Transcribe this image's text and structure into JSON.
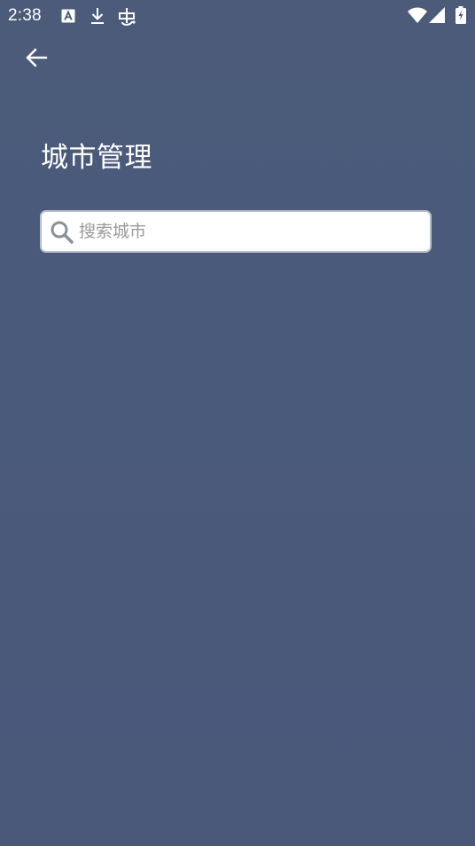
{
  "status_bar": {
    "time": "2:38",
    "left_icons": [
      "a-box-icon",
      "download-icon",
      "bug-icon"
    ],
    "right_icons": [
      "wifi-icon",
      "cell-signal-icon",
      "battery-charging-icon"
    ]
  },
  "header": {
    "back_icon": "arrow-left-icon",
    "title": "城市管理"
  },
  "search": {
    "placeholder": "搜索城市",
    "value": "",
    "icon": "search-icon"
  },
  "colors": {
    "background": "#4a5a7b",
    "text": "#ffffff",
    "search_bg": "#ffffff",
    "search_border": "#b9c0cc",
    "placeholder": "#9b9b9b"
  }
}
